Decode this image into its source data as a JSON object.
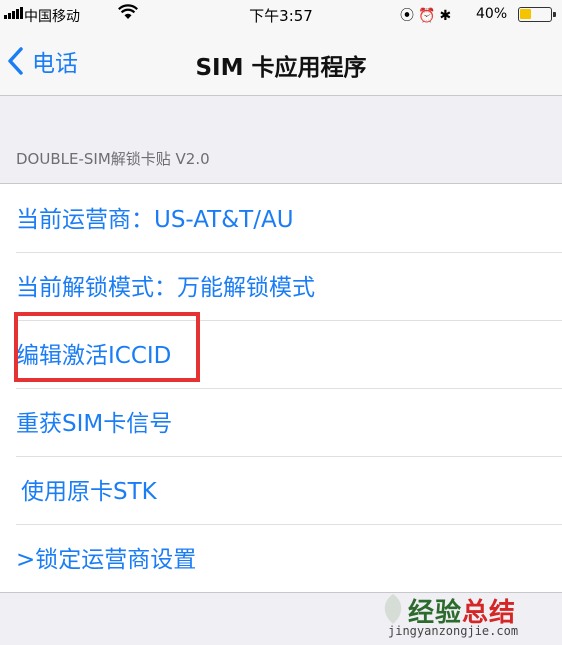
{
  "status_bar": {
    "carrier": "中国移动",
    "time": "下午3:57",
    "battery_percent": "40%",
    "battery_level": 0.4,
    "icons": [
      "signal-icon",
      "wifi-icon",
      "location-icon",
      "alarm-icon",
      "bluetooth-icon",
      "battery-icon"
    ]
  },
  "nav": {
    "back_label": "电话",
    "title": "SIM 卡应用程序"
  },
  "section": {
    "header": "DOUBLE-SIM解锁卡贴 V2.0"
  },
  "menu": {
    "items": [
      {
        "label": "当前运营商：US-AT&T/AU"
      },
      {
        "label": "当前解锁模式：万能解锁模式"
      },
      {
        "label": "编辑激活ICCID",
        "highlighted": true
      },
      {
        "label": "重获SIM卡信号"
      },
      {
        "label": " 使用原卡STK"
      },
      {
        "label": ">锁定运营商设置"
      }
    ]
  },
  "colors": {
    "link": "#1b7df5",
    "highlight": "#e53333",
    "background": "#efeff4"
  },
  "watermark": {
    "text_a": "经验",
    "text_b": "总结",
    "url": "jingyanzongjie.com"
  }
}
